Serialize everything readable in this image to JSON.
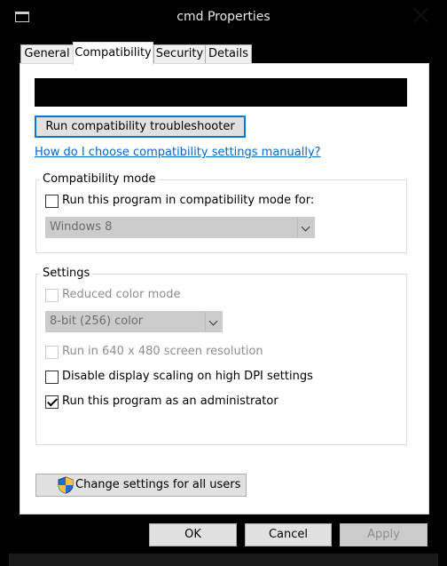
{
  "window": {
    "title": "cmd Properties"
  },
  "tabs": [
    {
      "label": "General",
      "active": false
    },
    {
      "label": "Compatibility",
      "active": true
    },
    {
      "label": "Security",
      "active": false
    },
    {
      "label": "Details",
      "active": false
    }
  ],
  "compat": {
    "troubleshooter_label": "Run compatibility troubleshooter",
    "manual_link": "How do I choose compatibility settings manually?",
    "mode_group_label": "Compatibility mode",
    "mode_checkbox_label": "Run this program in compatibility mode for:",
    "mode_checked": false,
    "mode_select_value": "Windows 8"
  },
  "settings": {
    "group_label": "Settings",
    "reduced_color_label": "Reduced color mode",
    "reduced_color_checked": false,
    "color_select_value": "8-bit (256) color",
    "res640_label": "Run in 640 x 480 screen resolution",
    "res640_checked": false,
    "dpi_label": "Disable display scaling on high DPI settings",
    "dpi_checked": false,
    "admin_label": "Run this program as an administrator",
    "admin_checked": true
  },
  "change_all_label": "Change settings for all users",
  "footer": {
    "ok": "OK",
    "cancel": "Cancel",
    "apply": "Apply"
  },
  "colors": {
    "accent": "#0078d7",
    "link": "#0066cc",
    "window_bg": "#000000",
    "panel_bg": "#ffffff"
  },
  "icons": {
    "app": "console-icon",
    "close": "close-icon",
    "shield": "uac-shield-icon"
  }
}
